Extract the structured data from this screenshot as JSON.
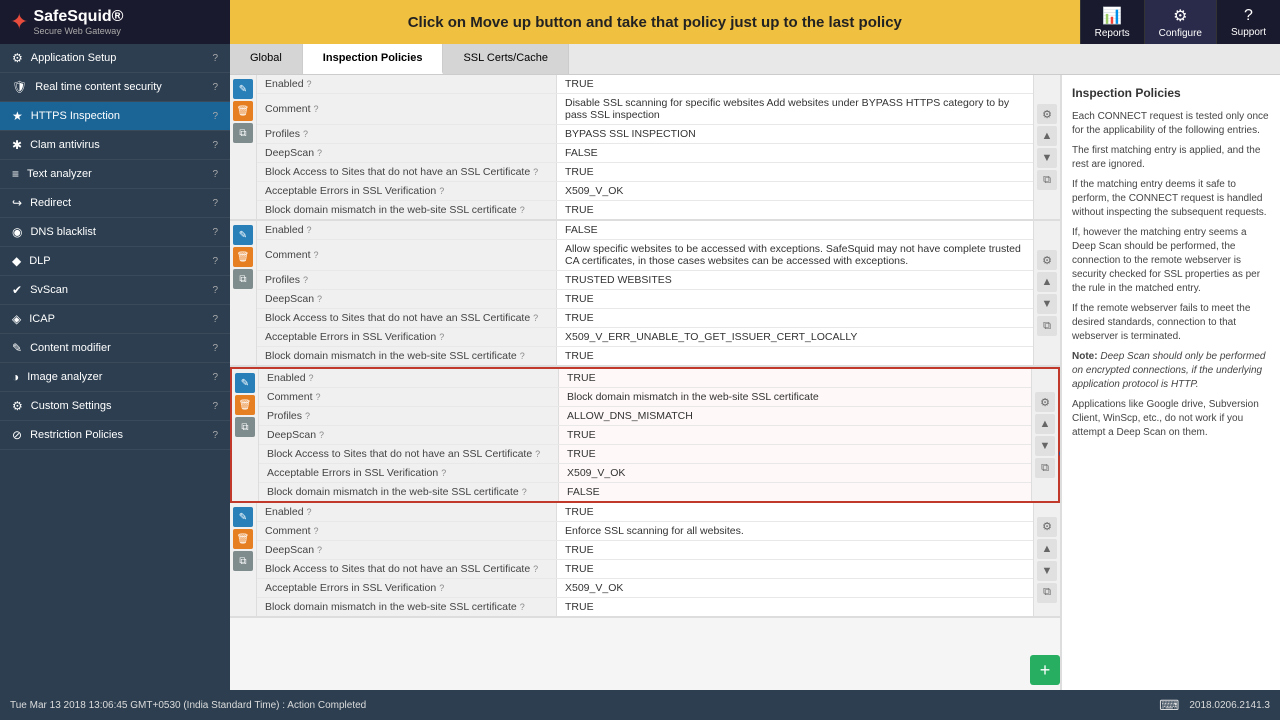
{
  "logo": {
    "icon": "✦",
    "title": "SafeSquid®",
    "subtitle": "Secure Web Gateway"
  },
  "announcement": "Click on Move up button and take that policy just up to the last policy",
  "nav": {
    "reports": "Reports",
    "configure": "Configure",
    "support": "Support"
  },
  "sidebar": {
    "items": [
      {
        "id": "application-setup",
        "icon": "⚙",
        "label": "Application Setup",
        "hasHelp": true
      },
      {
        "id": "realtime-content",
        "icon": "🛡",
        "label": "Real time content security",
        "hasHelp": true
      },
      {
        "id": "https-inspection",
        "icon": "★",
        "label": "HTTPS Inspection",
        "hasHelp": true,
        "active": true
      },
      {
        "id": "clam-antivirus",
        "icon": "✱",
        "label": "Clam antivirus",
        "hasHelp": true
      },
      {
        "id": "text-analyzer",
        "icon": "≡",
        "label": "Text analyzer",
        "hasHelp": true
      },
      {
        "id": "redirect",
        "icon": "↪",
        "label": "Redirect",
        "hasHelp": true
      },
      {
        "id": "dns-blacklist",
        "icon": "◉",
        "label": "DNS blacklist",
        "hasHelp": true
      },
      {
        "id": "dlp",
        "icon": "◆",
        "label": "DLP",
        "hasHelp": true
      },
      {
        "id": "svscan",
        "icon": "✔",
        "label": "SvScan",
        "hasHelp": true
      },
      {
        "id": "icap",
        "icon": "◈",
        "label": "ICAP",
        "hasHelp": true
      },
      {
        "id": "content-modifier",
        "icon": "✎",
        "label": "Content modifier",
        "hasHelp": true
      },
      {
        "id": "image-analyzer",
        "icon": "◑",
        "label": "Image analyzer",
        "hasHelp": true
      },
      {
        "id": "custom-settings",
        "icon": "⚙",
        "label": "Custom Settings",
        "hasHelp": true
      },
      {
        "id": "restriction-policies",
        "icon": "⊘",
        "label": "Restriction Policies",
        "hasHelp": true
      }
    ]
  },
  "tabs": [
    {
      "id": "global",
      "label": "Global"
    },
    {
      "id": "inspection-policies",
      "label": "Inspection Policies",
      "active": true
    },
    {
      "id": "ssl-certs",
      "label": "SSL Certs/Cache"
    }
  ],
  "policies": [
    {
      "id": "policy1",
      "fields": [
        {
          "label": "Enabled",
          "value": "TRUE",
          "hasHelp": true
        },
        {
          "label": "Comment",
          "value": "Disable SSL scanning for specific websites Add websites under BYPASS HTTPS category to by pass SSL inspection",
          "hasHelp": true
        },
        {
          "label": "Profiles",
          "value": "BYPASS SSL INSPECTION",
          "hasHelp": true
        },
        {
          "label": "DeepScan",
          "value": "FALSE",
          "hasHelp": true
        },
        {
          "label": "Block Access to Sites that do not have an SSL Certificate",
          "value": "TRUE",
          "hasHelp": true
        },
        {
          "label": "Acceptable Errors in SSL Verification",
          "value": "X509_V_OK",
          "hasHelp": true
        },
        {
          "label": "Block domain mismatch in the web-site SSL certificate",
          "value": "TRUE",
          "hasHelp": true
        }
      ]
    },
    {
      "id": "policy2",
      "fields": [
        {
          "label": "Enabled",
          "value": "FALSE",
          "hasHelp": true
        },
        {
          "label": "Comment",
          "value": "Allow specific websites to be accessed with exceptions. SafeSquid may not have complete trusted CA certificates, in those cases websites can be accessed with exceptions.",
          "hasHelp": true
        },
        {
          "label": "Profiles",
          "value": "TRUSTED WEBSITES",
          "hasHelp": true
        },
        {
          "label": "DeepScan",
          "value": "TRUE",
          "hasHelp": true
        },
        {
          "label": "Block Access to Sites that do not have an SSL Certificate",
          "value": "TRUE",
          "hasHelp": true
        },
        {
          "label": "Acceptable Errors in SSL Verification",
          "value": "X509_V_ERR_UNABLE_TO_GET_ISSUER_CERT_LOCALLY",
          "hasHelp": true
        },
        {
          "label": "Block domain mismatch in the web-site SSL certificate",
          "value": "TRUE",
          "hasHelp": true
        }
      ]
    },
    {
      "id": "policy3",
      "highlighted": true,
      "fields": [
        {
          "label": "Enabled",
          "value": "TRUE",
          "hasHelp": true
        },
        {
          "label": "Comment",
          "value": "Block domain mismatch in the web-site SSL certificate",
          "hasHelp": true
        },
        {
          "label": "Profiles",
          "value": "ALLOW_DNS_MISMATCH",
          "hasHelp": true
        },
        {
          "label": "DeepScan",
          "value": "TRUE",
          "hasHelp": true
        },
        {
          "label": "Block Access to Sites that do not have an SSL Certificate",
          "value": "TRUE",
          "hasHelp": true
        },
        {
          "label": "Acceptable Errors in SSL Verification",
          "value": "X509_V_OK",
          "hasHelp": true
        },
        {
          "label": "Block domain mismatch in the web-site SSL certificate",
          "value": "FALSE",
          "hasHelp": true
        }
      ]
    },
    {
      "id": "policy4",
      "fields": [
        {
          "label": "Enabled",
          "value": "TRUE",
          "hasHelp": true
        },
        {
          "label": "Comment",
          "value": "Enforce SSL scanning for all websites.",
          "hasHelp": true
        },
        {
          "label": "DeepScan",
          "value": "TRUE",
          "hasHelp": true
        },
        {
          "label": "Block Access to Sites that do not have an SSL Certificate",
          "value": "TRUE",
          "hasHelp": true
        },
        {
          "label": "Acceptable Errors in SSL Verification",
          "value": "X509_V_OK",
          "hasHelp": true
        },
        {
          "label": "Block domain mismatch in the web-site SSL certificate",
          "value": "TRUE",
          "hasHelp": true
        }
      ]
    }
  ],
  "right_panel": {
    "title": "Inspection Policies",
    "paragraphs": [
      "Each CONNECT request is tested only once for the applicability of the following entries.",
      "The first matching entry is applied, and the rest are ignored.",
      "If the matching entry deems it safe to perform, the connection to the remote webserver is handled without inspecting the subsequent requests.",
      "If, however the matching entry seems a Deep Scan should be performed, the connection to the remote webserver is security checked for SSL properties as per the rule in the matched entry.",
      "If the remote webserver fails to meet the desired standards, connection to that webserver is terminated.",
      "Note: Deep Scan should only be performed on encrypted connections, if the underlying application protocol is HTTP.",
      "Applications like Google drive, Subversion Client, WinScp, etc., do not work if you attempt a Deep Scan on them."
    ]
  },
  "status_bar": {
    "left": "Tue Mar 13 2018 13:06:45 GMT+0530 (India Standard Time) : Action Completed",
    "right": "2018.0206.2141.3"
  }
}
